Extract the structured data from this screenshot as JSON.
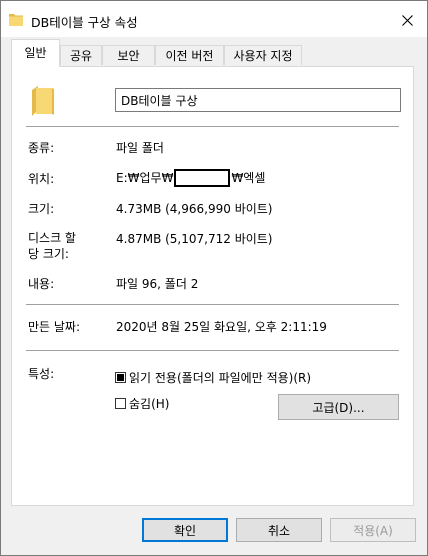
{
  "window": {
    "title": "DB테이블 구상 속성",
    "icon": "folder-icon"
  },
  "tabs": [
    {
      "label": "일반",
      "active": true
    },
    {
      "label": "공유",
      "active": false
    },
    {
      "label": "보안",
      "active": false
    },
    {
      "label": "이전 버전",
      "active": false
    },
    {
      "label": "사용자 지정",
      "active": false
    }
  ],
  "general": {
    "name_value": "DB테이블 구상",
    "type_label": "종류:",
    "type_value": "파일 폴더",
    "location_label": "위치:",
    "location_prefix": "E:₩업무₩",
    "location_suffix": "₩엑셀",
    "size_label": "크기:",
    "size_value": "4.73MB (4,966,990 바이트)",
    "disk_label_1": "디스크 할",
    "disk_label_2": "당 크기:",
    "disk_value": "4.87MB (5,107,712 바이트)",
    "contents_label": "내용:",
    "contents_value": "파일 96, 폴더 2",
    "created_label": "만든 날짜:",
    "created_value": "2020년 8월 25일 화요일, 오후 2:11:19",
    "attributes_label": "특성:",
    "readonly_label": "읽기 전용(폴더의 파일에만 적용)(R)",
    "readonly_state": "indeterminate",
    "hidden_label": "숨김(H)",
    "hidden_checked": false,
    "advanced_label": "고급(D)..."
  },
  "buttons": {
    "ok": "확인",
    "cancel": "취소",
    "apply": "적용(A)"
  },
  "colors": {
    "folder": "#f8d775",
    "folder_shade": "#e6b94c",
    "primary_border": "#0078d7"
  }
}
